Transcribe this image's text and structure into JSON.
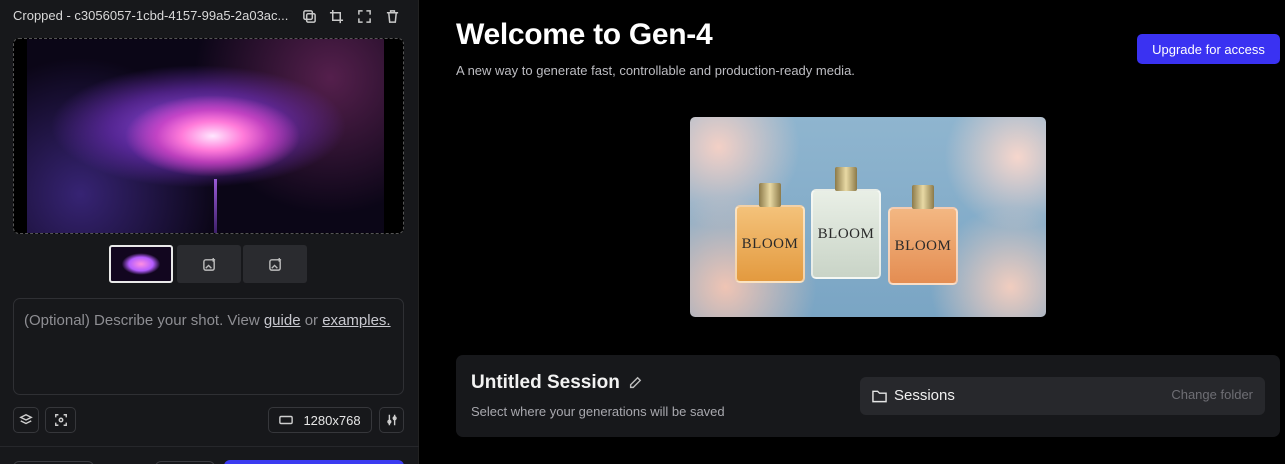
{
  "left_panel": {
    "file_name": "Cropped - c3056057-1cbd-4157-99a5-2a03ac...",
    "tools": [
      "duplicate-icon",
      "crop-icon",
      "expand-icon",
      "trash-icon"
    ],
    "prompt": {
      "prefix": "(Optional) Describe your shot. View ",
      "guide": "guide",
      "or": " or ",
      "examples": "examples."
    },
    "resolution": "1280x768"
  },
  "main": {
    "title": "Welcome to Gen-4",
    "subtitle": "A new way to generate fast, controllable and production-ready media.",
    "upgrade_label": "Upgrade for access",
    "hero_labels": [
      "BLOOM",
      "BLOOM",
      "BLOOM"
    ],
    "session": {
      "title": "Untitled Session",
      "subtitle": "Select where your generations will be saved",
      "folder_label": "Sessions",
      "change_folder": "Change folder"
    }
  },
  "colors": {
    "accent": "#3a32f2",
    "panel": "#17181b",
    "background": "#000000"
  }
}
